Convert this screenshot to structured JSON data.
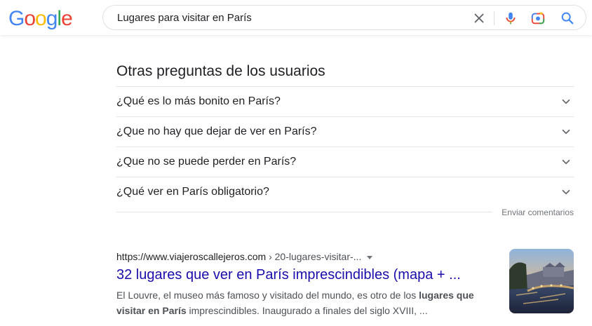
{
  "logo": {
    "letters": [
      "G",
      "o",
      "o",
      "g",
      "l",
      "e"
    ],
    "colors": [
      "#4285F4",
      "#EA4335",
      "#FBBC05",
      "#4285F4",
      "#34A853",
      "#EA4335"
    ]
  },
  "search": {
    "query": "Lugares para visitar en París",
    "icons": [
      "close-icon",
      "mic-icon",
      "lens-icon",
      "search-icon"
    ]
  },
  "paa": {
    "title": "Otras preguntas de los usuarios",
    "questions": [
      "¿Qué es lo más bonito en París?",
      "¿Que no hay que dejar de ver en París?",
      "¿Que no se puede perder en París?",
      "¿Qué ver en París obligatorio?"
    ],
    "feedback": "Enviar comentarios"
  },
  "result": {
    "domain": "https://www.viajeroscallejeros.com",
    "path": " › 20-lugares-visitar-...",
    "title": "32 lugares que ver en París imprescindibles (mapa + ...",
    "snippet_1": "El Louvre, el museo más famoso y visitado del mundo, es otro de los ",
    "snippet_bold_1": "lugares que visitar en París",
    "snippet_2": " imprescindibles. Inaugurado a finales del siglo XVIII, ..."
  },
  "colors": {
    "link": "#1a0dab",
    "text": "#202124",
    "muted": "#70757a"
  }
}
